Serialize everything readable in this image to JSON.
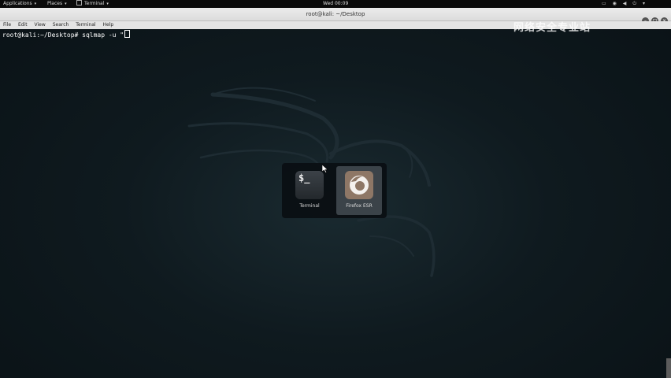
{
  "top_panel": {
    "applications_label": "Applications",
    "places_label": "Places",
    "terminal_label": "Terminal",
    "clock": "Wed 00:09"
  },
  "terminal_window": {
    "title": "root@kali: ~/Desktop",
    "menu": [
      "File",
      "Edit",
      "View",
      "Search",
      "Terminal",
      "Help"
    ],
    "prompt": "root@kali:~/Desktop# sqlmap -u \""
  },
  "watermark": {
    "text": "网络安全专业站"
  },
  "app_switcher": {
    "items": [
      {
        "label": "Terminal",
        "icon": "terminal-icon",
        "selected": false,
        "icon_text": "$_"
      },
      {
        "label": "Firefox ESR",
        "icon": "firefox-icon",
        "selected": true
      }
    ]
  },
  "colors": {
    "background": "#0f1a1f",
    "panel": "#0b0b0b",
    "switcher_highlight": "#3b4349",
    "firefox_tile": "#8e7766"
  }
}
